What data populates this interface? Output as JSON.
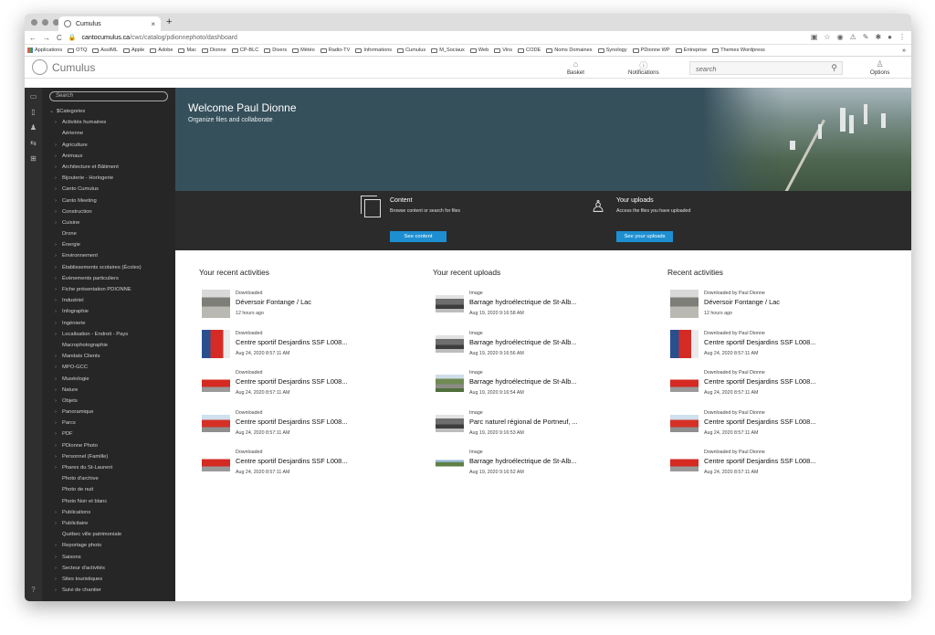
{
  "browser": {
    "tab_title": "Cumulus",
    "tab_close": "×",
    "new_tab": "+",
    "url_host": "cantocumulus.ca",
    "url_path": "/cwc/catalog/pdionnephoto/dashboard",
    "bookmarks": [
      "Applications",
      "OTQ",
      "AssIML",
      "Apple",
      "Adobe",
      "Mac",
      "Dionne",
      "CP-BLC",
      "Divers",
      "Météo",
      "Radio-TV",
      "Informations",
      "Cumulus",
      "M_Sociaux",
      "Web",
      "Vins",
      "CODE",
      "Noms Domaines",
      "Synology",
      "PDionne WP",
      "Entreprise",
      "Themes Wordpress"
    ],
    "bookmarks_more": "»"
  },
  "app": {
    "logo_text": "Cumulus",
    "basket_label": "Basket",
    "notifications_label": "Notifications",
    "search_placeholder": "search",
    "options_label": "Options"
  },
  "sidebar": {
    "search_placeholder": "Search",
    "root_label": "$Categories",
    "categories": [
      {
        "label": "Activités humaines",
        "has_children": true
      },
      {
        "label": "Aérienne",
        "has_children": false
      },
      {
        "label": "Agriculture",
        "has_children": true
      },
      {
        "label": "Animaux",
        "has_children": true
      },
      {
        "label": "Architecture et Bâtiment",
        "has_children": true
      },
      {
        "label": "Bijouterie - Horlogerie",
        "has_children": true
      },
      {
        "label": "Canto Cumulus",
        "has_children": true
      },
      {
        "label": "Canto Meeting",
        "has_children": true
      },
      {
        "label": "Construction",
        "has_children": true
      },
      {
        "label": "Cuisine",
        "has_children": true
      },
      {
        "label": "Drone",
        "has_children": false
      },
      {
        "label": "Énergie",
        "has_children": true
      },
      {
        "label": "Environnement",
        "has_children": true
      },
      {
        "label": "Établissements scolaires (Écoles)",
        "has_children": true
      },
      {
        "label": "Événements particuliers",
        "has_children": true
      },
      {
        "label": "Fiche présentation PDIONNE",
        "has_children": true
      },
      {
        "label": "Industriel",
        "has_children": true
      },
      {
        "label": "Infographie",
        "has_children": true
      },
      {
        "label": "Ingénierie",
        "has_children": true
      },
      {
        "label": "Localisation - Endroit - Pays",
        "has_children": true
      },
      {
        "label": "Macrophotographie",
        "has_children": false
      },
      {
        "label": "Mandats Clients",
        "has_children": true
      },
      {
        "label": "MPO-GCC",
        "has_children": true
      },
      {
        "label": "Muséologie",
        "has_children": true
      },
      {
        "label": "Nature",
        "has_children": true
      },
      {
        "label": "Objets",
        "has_children": true
      },
      {
        "label": "Panoramique",
        "has_children": true
      },
      {
        "label": "Parcs",
        "has_children": true
      },
      {
        "label": "PDF",
        "has_children": true
      },
      {
        "label": "PDionne Photo",
        "has_children": true
      },
      {
        "label": "Personnel (Famille)",
        "has_children": true
      },
      {
        "label": "Phares du St-Laurent",
        "has_children": true
      },
      {
        "label": "Photo d'archive",
        "has_children": false
      },
      {
        "label": "Photo de nuit",
        "has_children": false
      },
      {
        "label": "Photo Noir et blanc",
        "has_children": false
      },
      {
        "label": "Publications",
        "has_children": true
      },
      {
        "label": "Publicitaire",
        "has_children": true
      },
      {
        "label": "Québec ville patrimoniale",
        "has_children": false
      },
      {
        "label": "Reportage photo",
        "has_children": true
      },
      {
        "label": "Saisons",
        "has_children": true
      },
      {
        "label": "Secteur d'activités",
        "has_children": true
      },
      {
        "label": "Sites touristiques",
        "has_children": true
      },
      {
        "label": "Suivi de chantier",
        "has_children": true
      }
    ]
  },
  "hero": {
    "title": "Welcome Paul Dionne",
    "subtitle": "Organize files and collaborate"
  },
  "features": {
    "content": {
      "title": "Content",
      "subtitle": "Browse content or search for files",
      "button": "See content"
    },
    "uploads": {
      "title": "Your uploads",
      "subtitle": "Access the files you have uploaded",
      "button": "See your uploads"
    }
  },
  "columns": [
    {
      "heading": "Your recent activities",
      "items": [
        {
          "type": "Downloaded",
          "title": "Déversoir Fontange / Lac",
          "date": "12 hours ago",
          "thumb": "dam"
        },
        {
          "type": "Downloaded",
          "title": "Centre sportif Desjardins SSF L008...",
          "date": "Aug 24, 2020 8:57:11 AM",
          "thumb": "red-vertical"
        },
        {
          "type": "Downloaded",
          "title": "Centre sportif Desjardins SSF L008...",
          "date": "Aug 24, 2020 8:57:11 AM",
          "thumb": "red-building"
        },
        {
          "type": "Downloaded",
          "title": "Centre sportif Desjardins SSF L008...",
          "date": "Aug 24, 2020 8:57:11 AM",
          "thumb": "red-building-sky"
        },
        {
          "type": "Downloaded",
          "title": "Centre sportif Desjardins SSF L008...",
          "date": "Aug 24, 2020 8:57:11 AM",
          "thumb": "red-building"
        }
      ]
    },
    {
      "heading": "Your recent uploads",
      "items": [
        {
          "type": "Image",
          "title": "Barrage hydroélectrique de St-Alb...",
          "date": "Aug 19, 2020 9:16:58 AM",
          "thumb": "bw-dam"
        },
        {
          "type": "Image",
          "title": "Barrage hydroélectrique de St-Alb...",
          "date": "Aug 19, 2020 9:16:56 AM",
          "thumb": "bw-dam"
        },
        {
          "type": "Image",
          "title": "Barrage hydroélectrique de St-Alb...",
          "date": "Aug 19, 2020 9:16:54 AM",
          "thumb": "green-dam"
        },
        {
          "type": "Image",
          "title": "Parc naturel régional de Portneuf, ...",
          "date": "Aug 19, 2020 9:16:53 AM",
          "thumb": "bw-dam"
        },
        {
          "type": "Image",
          "title": "Barrage hydroélectrique de St-Alb...",
          "date": "Aug 19, 2020 9:16:52 AM",
          "thumb": "green-wide"
        }
      ]
    },
    {
      "heading": "Recent activities",
      "items": [
        {
          "type": "Downloaded by Paul Dionne",
          "title": "Déversoir Fontange / Lac",
          "date": "12 hours ago",
          "thumb": "dam"
        },
        {
          "type": "Downloaded by Paul Dionne",
          "title": "Centre sportif Desjardins SSF L008...",
          "date": "Aug 24, 2020 8:57:11 AM",
          "thumb": "red-vertical"
        },
        {
          "type": "Downloaded by Paul Dionne",
          "title": "Centre sportif Desjardins SSF L008...",
          "date": "Aug 24, 2020 8:57:11 AM",
          "thumb": "red-building"
        },
        {
          "type": "Downloaded by Paul Dionne",
          "title": "Centre sportif Desjardins SSF L008...",
          "date": "Aug 24, 2020 8:57:11 AM",
          "thumb": "red-building-sky"
        },
        {
          "type": "Downloaded by Paul Dionne",
          "title": "Centre sportif Desjardins SSF L008...",
          "date": "Aug 24, 2020 8:57:11 AM",
          "thumb": "red-building"
        }
      ]
    }
  ],
  "colors": {
    "accent": "#1d8fd1",
    "hero_bg": "#36505b",
    "sidebar_bg": "#262626",
    "strip_bg": "#2b2b2b"
  }
}
